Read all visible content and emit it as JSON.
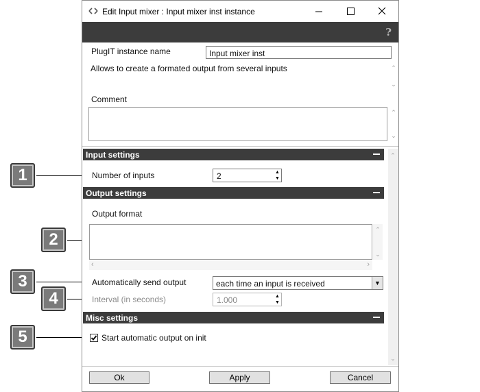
{
  "window": {
    "title": "Edit Input mixer : Input mixer inst instance",
    "help_icon": "?"
  },
  "instance": {
    "name_label": "PlugIT instance name",
    "name_value": "Input mixer inst",
    "description": "Allows to create a formated output from several inputs",
    "comment_label": "Comment",
    "comment_value": ""
  },
  "input_settings": {
    "header": "Input settings",
    "number_label": "Number of inputs",
    "number_value": "2"
  },
  "output_settings": {
    "header": "Output settings",
    "format_label": "Output format",
    "format_value": "",
    "auto_send_label": "Automatically send output",
    "auto_send_value": "each time an input is received",
    "interval_label": "Interval (in seconds)",
    "interval_value": "1.000"
  },
  "misc_settings": {
    "header": "Misc settings",
    "auto_output_label": "Start automatic output on init",
    "auto_output_checked": true
  },
  "buttons": {
    "ok": "Ok",
    "apply": "Apply",
    "cancel": "Cancel"
  },
  "callouts": [
    "1",
    "2",
    "3",
    "4",
    "5"
  ],
  "icons": {
    "app": "app-icon",
    "minimize": "minimize-icon",
    "maximize": "maximize-icon",
    "close": "close-icon",
    "help": "help-icon",
    "collapse": "minus-icon",
    "spin_up": "up-arrow-icon",
    "spin_down": "down-arrow-icon",
    "dropdown": "chevron-down-icon",
    "check": "check-icon"
  }
}
